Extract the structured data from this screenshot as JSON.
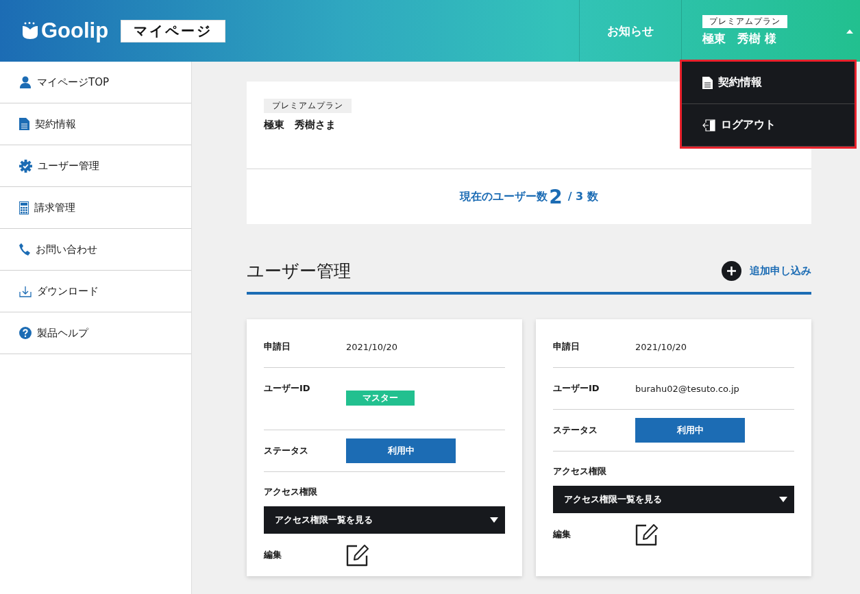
{
  "header": {
    "logo": "Goolip",
    "page_label": "マイページ",
    "notice_link": "お知らせ",
    "plan": "プレミアムプラン",
    "user_name": "極東　秀樹 様",
    "menu_expanded": true
  },
  "user_menu": [
    {
      "kind": "document",
      "label": "契約情報"
    },
    {
      "kind": "logout",
      "label": "ログアウト"
    }
  ],
  "sidebar": {
    "items": [
      {
        "kind": "person",
        "label": "マイページTOP"
      },
      {
        "kind": "document",
        "label": "契約情報"
      },
      {
        "kind": "gear",
        "label": "ユーザー管理"
      },
      {
        "kind": "calculator",
        "label": "請求管理"
      },
      {
        "kind": "phone",
        "label": "お問い合わせ"
      },
      {
        "kind": "download",
        "label": "ダウンロード"
      },
      {
        "kind": "help",
        "label": "製品ヘルプ"
      }
    ]
  },
  "profile": {
    "plan": "プレミアムプラン",
    "name": "極東　秀樹さま",
    "count_label": "現在のユーザー数",
    "count_current": "2",
    "count_total": "/ 3 数"
  },
  "section": {
    "title": "ユーザー管理",
    "add_link": "追加申し込み"
  },
  "users": [
    {
      "rows": [
        {
          "kind": "text",
          "label": "申請日",
          "value": "2021/10/20"
        },
        {
          "kind": "tag",
          "label": "ユーザーID",
          "value": "マスター"
        },
        {
          "kind": "status",
          "label": "ステータス",
          "value": "利用中"
        }
      ],
      "access_label": "アクセス権限",
      "access_dropdown": "アクセス権限一覧を見る",
      "edit_label": "編集"
    },
    {
      "rows": [
        {
          "kind": "text",
          "label": "申請日",
          "value": "2021/10/20"
        },
        {
          "kind": "text",
          "label": "ユーザーID",
          "value": "burahu02@tesuto.co.jp"
        },
        {
          "kind": "status",
          "label": "ステータス",
          "value": "利用中"
        }
      ],
      "access_label": "アクセス権限",
      "access_dropdown": "アクセス権限一覧を見る",
      "edit_label": "編集"
    }
  ]
}
